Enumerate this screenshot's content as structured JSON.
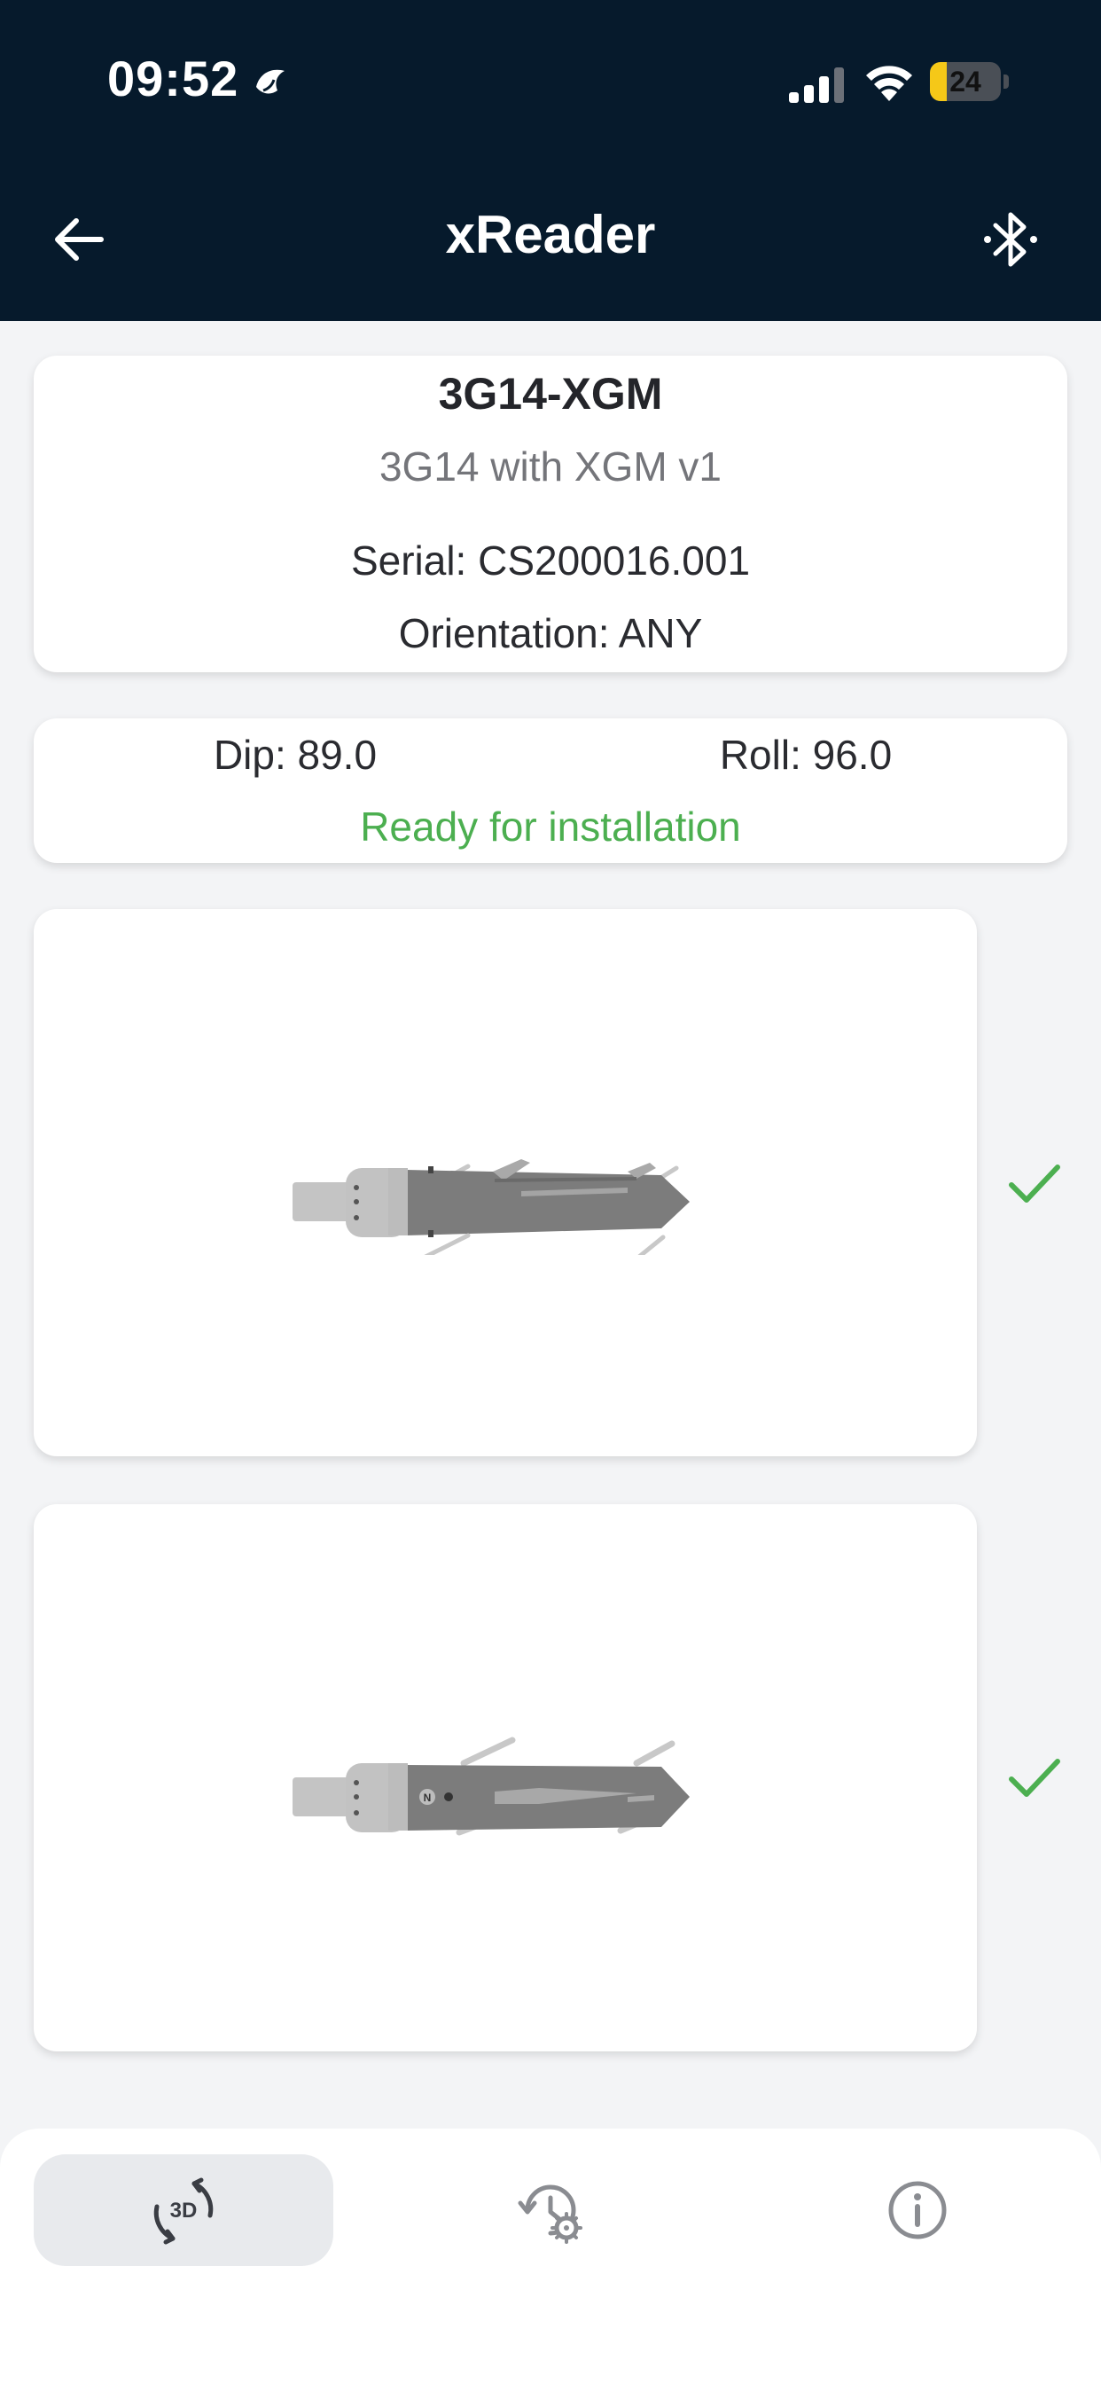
{
  "status_bar": {
    "time": "09:52",
    "focus_icon": "sleep-moon-icon",
    "battery_level": "24",
    "battery_percent": 24,
    "signal_bars": 3
  },
  "app_bar": {
    "title": "xReader",
    "back_icon": "arrow-left-icon",
    "bluetooth_icon": "bluetooth-icon"
  },
  "device": {
    "name": "3G14-XGM",
    "description": "3G14 with XGM v1",
    "serial": "Serial: CS200016.001",
    "orientation": "Orientation: ANY"
  },
  "readings": {
    "dip": "Dip: 89.0",
    "roll": "Roll: 96.0",
    "status": "Ready for installation",
    "status_color": "#4caf50"
  },
  "views": [
    {
      "name": "side-view",
      "status_icon": "check-icon",
      "marker": ""
    },
    {
      "name": "top-view",
      "status_icon": "check-icon",
      "marker": "N"
    }
  ],
  "bottom_nav": {
    "tabs": [
      {
        "id": "3d",
        "icon": "rotate-3d-icon",
        "icon_text": "3D",
        "active": true
      },
      {
        "id": "history",
        "icon": "history-settings-icon",
        "active": false
      },
      {
        "id": "info",
        "icon": "info-icon",
        "active": false
      }
    ]
  },
  "colors": {
    "header_bg": "#061a2c",
    "page_bg": "#f3f4f6",
    "accent_green": "#4caf50",
    "battery_yellow": "#f5c818"
  }
}
